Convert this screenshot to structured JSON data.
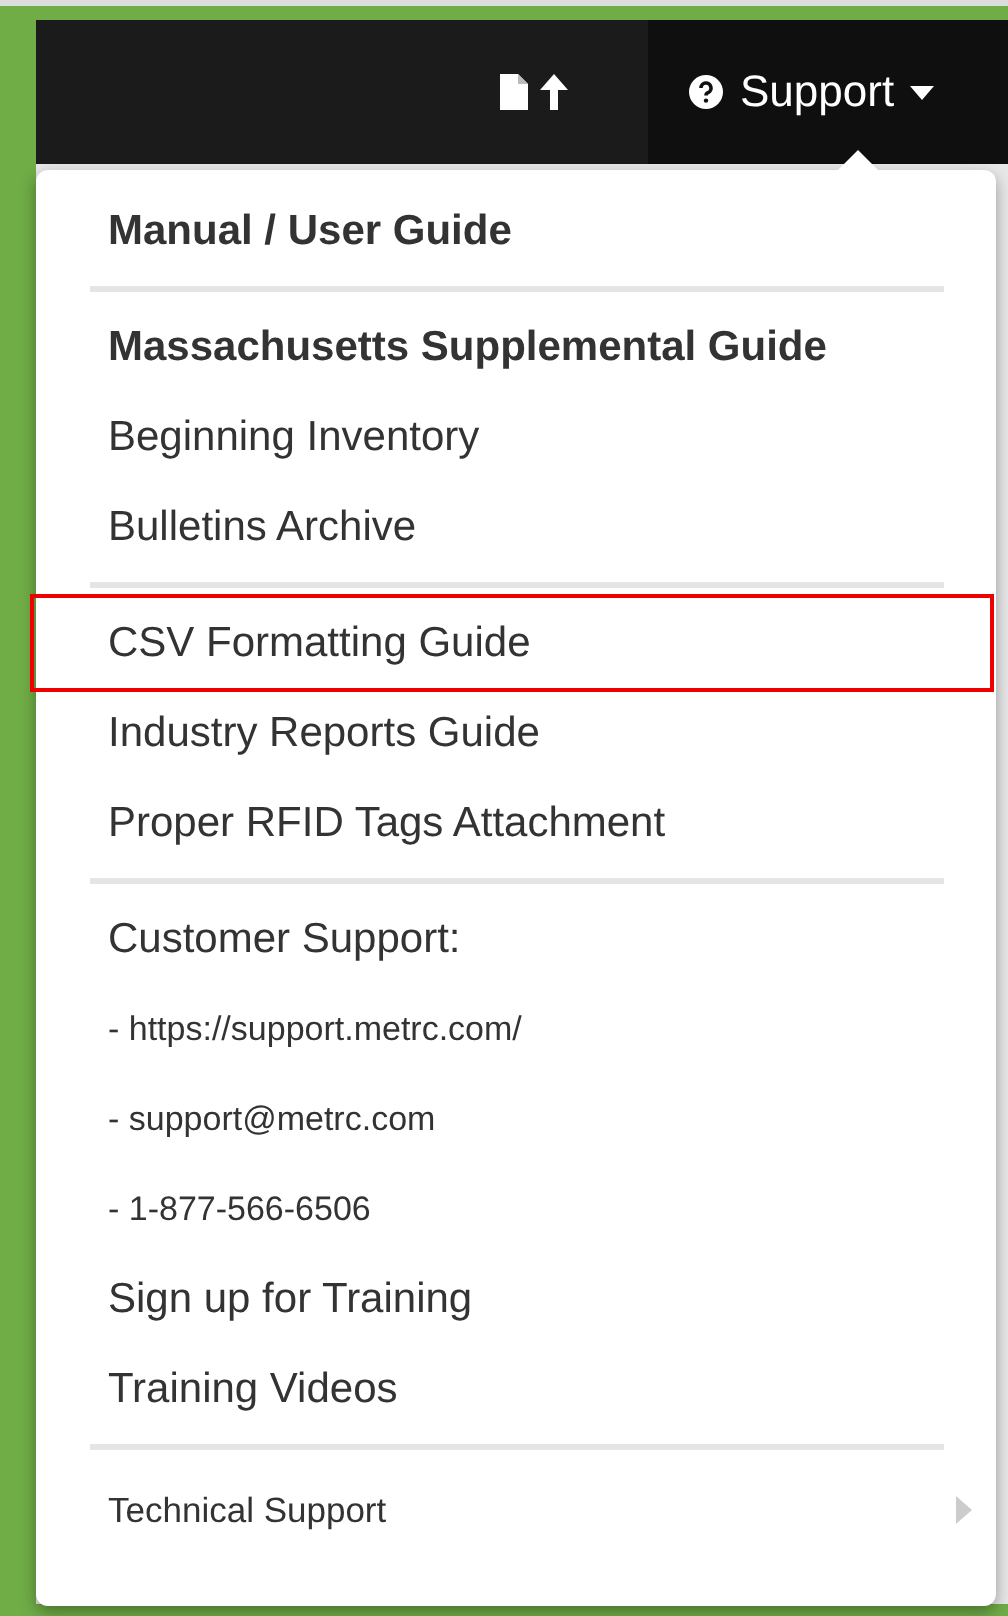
{
  "navbar": {
    "support_menu": {
      "label": "Support",
      "expanded": true
    }
  },
  "menu": [
    {
      "kind": "header",
      "label": "Manual / User Guide",
      "highlighted": false
    },
    {
      "kind": "divider"
    },
    {
      "kind": "header",
      "label": "Massachusetts Supplemental Guide",
      "highlighted": false
    },
    {
      "kind": "link",
      "label": "Beginning Inventory",
      "highlighted": false
    },
    {
      "kind": "link",
      "label": "Bulletins Archive",
      "highlighted": false
    },
    {
      "kind": "divider"
    },
    {
      "kind": "link",
      "label": "CSV Formatting Guide",
      "highlighted": true
    },
    {
      "kind": "link",
      "label": "Industry Reports Guide",
      "highlighted": false
    },
    {
      "kind": "link",
      "label": "Proper RFID Tags Attachment",
      "highlighted": false
    },
    {
      "kind": "divider"
    },
    {
      "kind": "label",
      "label": "Customer Support:",
      "highlighted": false
    },
    {
      "kind": "small",
      "label": "- https://support.metrc.com/",
      "highlighted": false
    },
    {
      "kind": "small",
      "label": "- support@metrc.com",
      "highlighted": false
    },
    {
      "kind": "small",
      "label": "- 1-877-566-6506",
      "highlighted": false
    },
    {
      "kind": "link",
      "label": "Sign up for Training",
      "highlighted": false
    },
    {
      "kind": "link",
      "label": "Training Videos",
      "highlighted": false
    },
    {
      "kind": "divider"
    },
    {
      "kind": "submenu",
      "label": "Technical Support",
      "highlighted": false
    }
  ]
}
